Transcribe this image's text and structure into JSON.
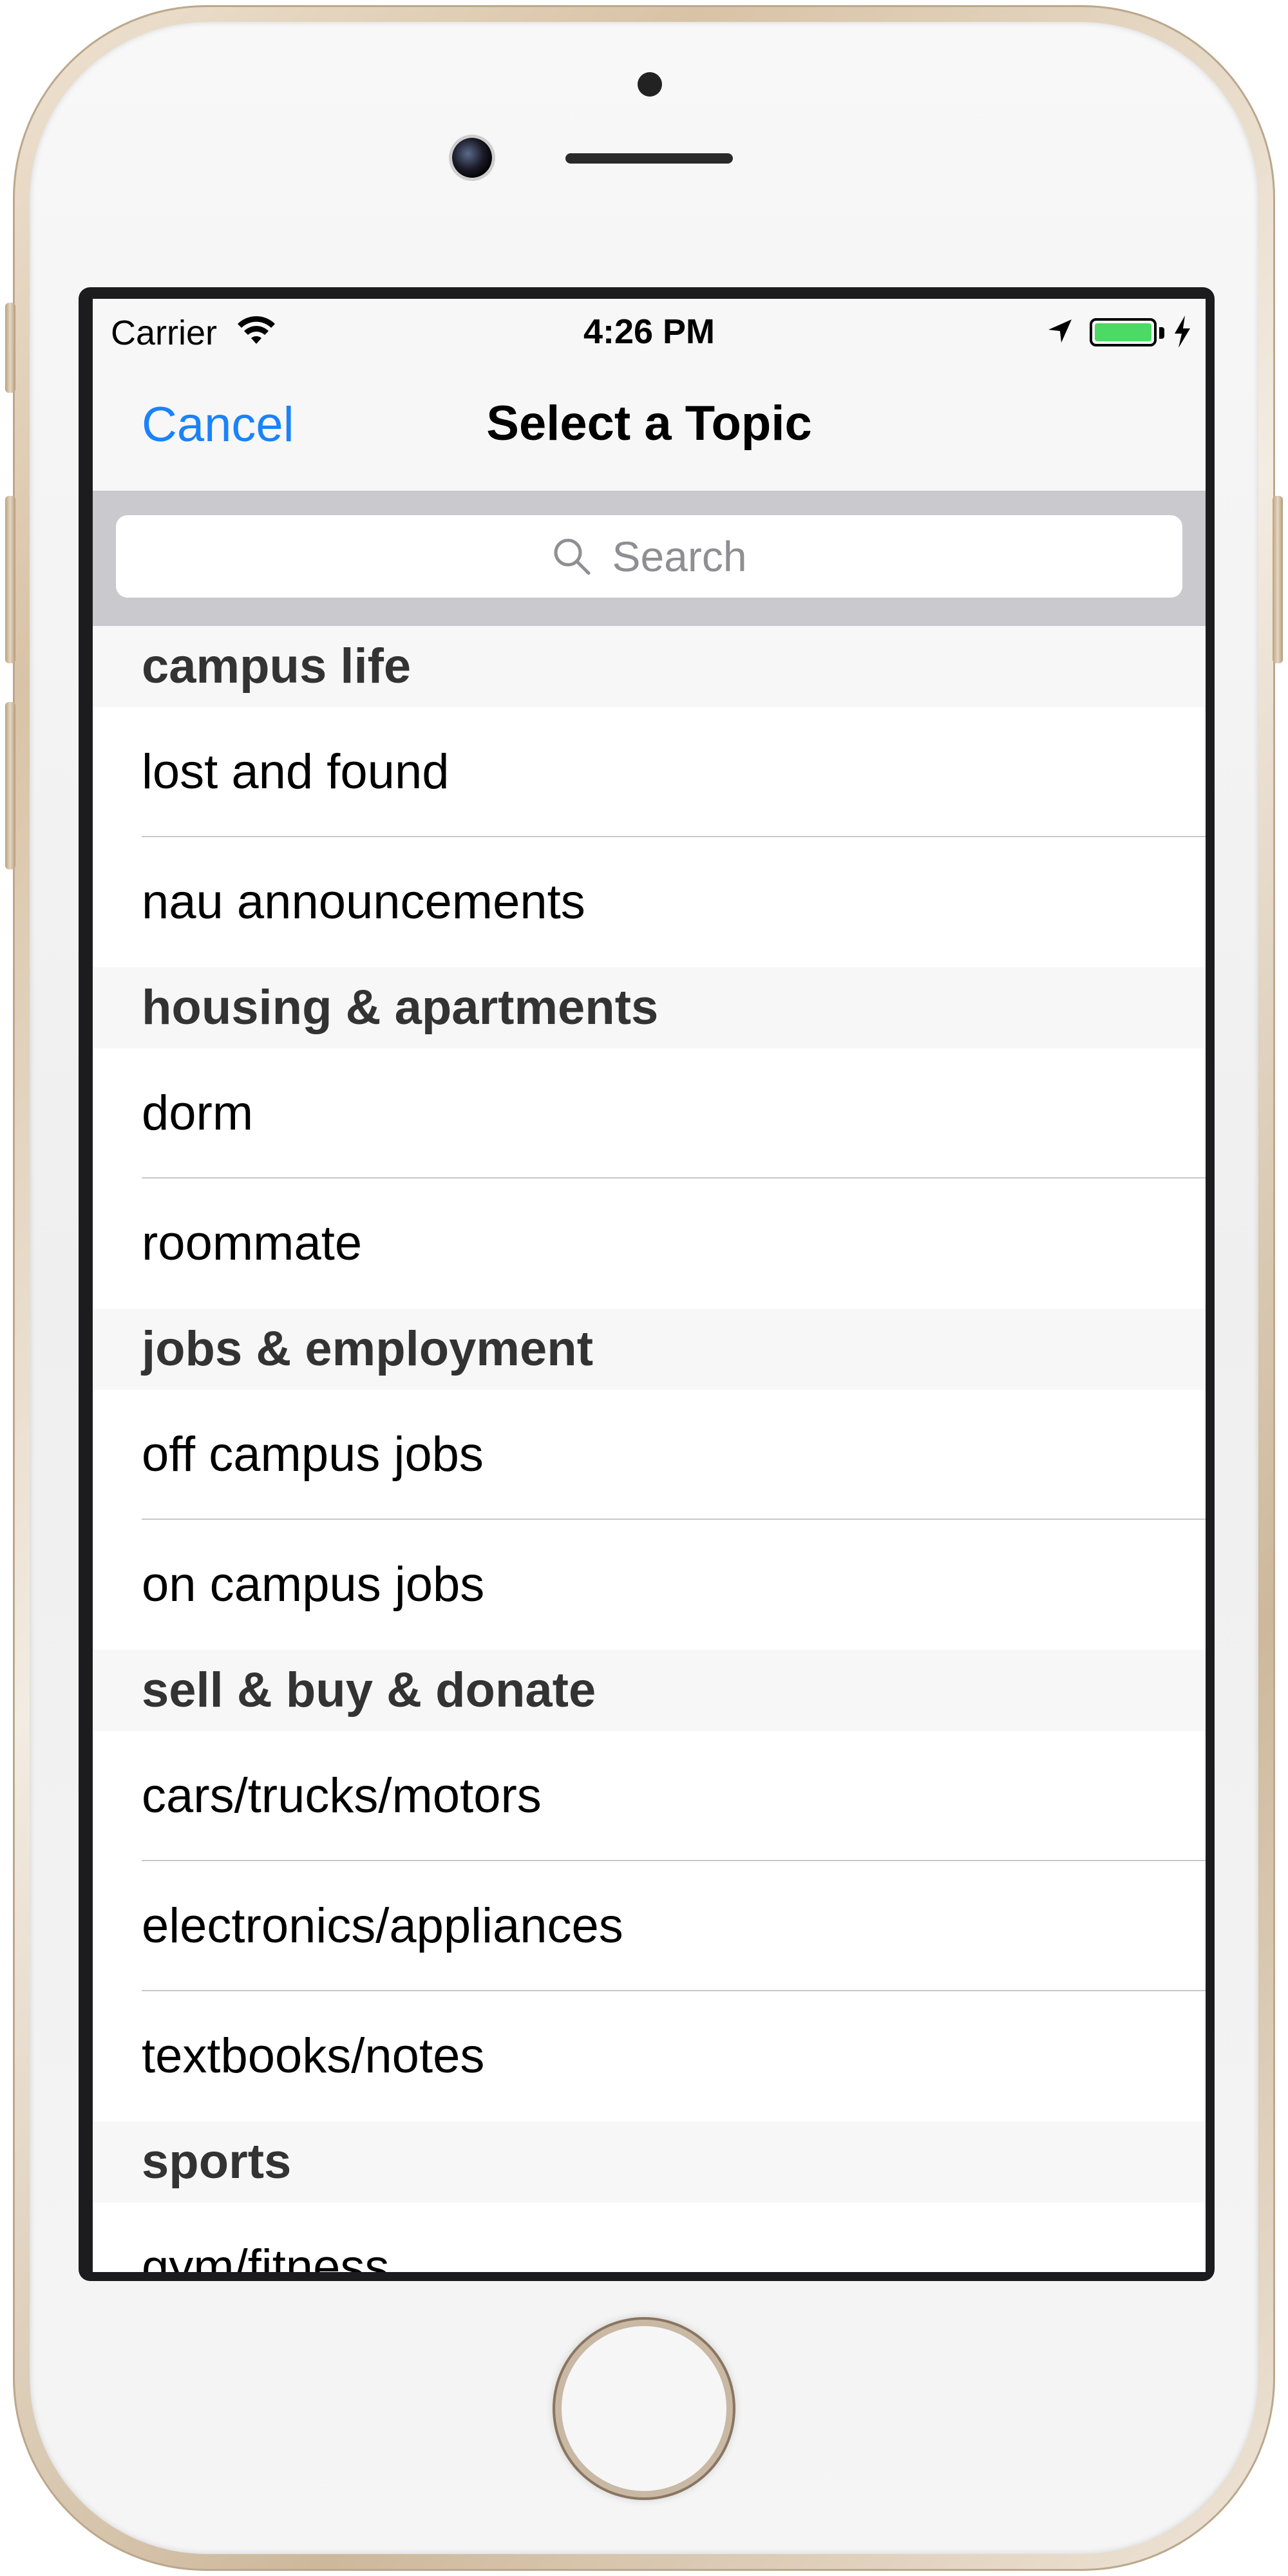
{
  "status_bar": {
    "carrier": "Carrier",
    "time": "4:26 PM",
    "battery_color": "#4cd964"
  },
  "nav": {
    "cancel_label": "Cancel",
    "title": "Select a Topic",
    "accent_color": "#1a82fb"
  },
  "search": {
    "placeholder": "Search",
    "icon": "search-icon"
  },
  "sections": [
    {
      "header": "campus life",
      "items": [
        "lost and found",
        "nau announcements"
      ]
    },
    {
      "header": "housing & apartments",
      "items": [
        "dorm",
        "roommate"
      ]
    },
    {
      "header": "jobs & employment",
      "items": [
        "off campus jobs",
        "on campus jobs"
      ]
    },
    {
      "header": "sell & buy & donate",
      "items": [
        "cars/trucks/motors",
        "electronics/appliances",
        "textbooks/notes"
      ]
    },
    {
      "header": "sports",
      "items": [
        "gym/fitness"
      ]
    }
  ]
}
